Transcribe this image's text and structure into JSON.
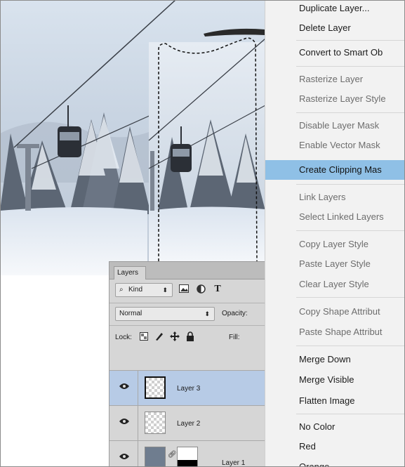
{
  "layers_panel": {
    "tab_label": "Layers",
    "filter_kind": "Kind",
    "blend_mode": "Normal",
    "opacity_label": "Opacity:",
    "lock_label": "Lock:",
    "fill_label": "Fill:",
    "type_filter_glyph": "T",
    "layers": [
      {
        "name": "Layer 3",
        "selected": true
      },
      {
        "name": "Layer 2",
        "selected": false
      },
      {
        "name": "Layer 1",
        "selected": false
      }
    ]
  },
  "context_menu": {
    "items": [
      {
        "label": "Duplicate Layer...",
        "state": "enabled"
      },
      {
        "label": "Delete Layer",
        "state": "enabled"
      },
      {
        "label": "Convert to Smart Ob",
        "state": "enabled"
      },
      {
        "label": "Rasterize Layer",
        "state": "disabled"
      },
      {
        "label": "Rasterize Layer Style",
        "state": "disabled"
      },
      {
        "label": "Disable Layer Mask",
        "state": "disabled"
      },
      {
        "label": "Enable Vector Mask",
        "state": "disabled"
      },
      {
        "label": "Create Clipping Mas",
        "state": "highlighted"
      },
      {
        "label": "Link Layers",
        "state": "disabled"
      },
      {
        "label": "Select Linked Layers",
        "state": "disabled"
      },
      {
        "label": "Copy Layer Style",
        "state": "disabled"
      },
      {
        "label": "Paste Layer Style",
        "state": "disabled"
      },
      {
        "label": "Clear Layer Style",
        "state": "disabled"
      },
      {
        "label": "Copy Shape Attribut",
        "state": "disabled"
      },
      {
        "label": "Paste Shape Attribut",
        "state": "disabled"
      },
      {
        "label": "Merge Down",
        "state": "enabled"
      },
      {
        "label": "Merge Visible",
        "state": "enabled"
      },
      {
        "label": "Flatten Image",
        "state": "enabled"
      },
      {
        "label": "No Color",
        "state": "enabled"
      },
      {
        "label": "Red",
        "state": "enabled"
      },
      {
        "label": "Orange",
        "state": "enabled"
      }
    ]
  },
  "colors": {
    "menu_background": "#f2f2f2",
    "menu_highlight": "#8fc0e6",
    "menu_disabled_text": "#6d6d6d",
    "panel_background": "#d6d6d6",
    "selected_layer": "#b7cbe6"
  }
}
